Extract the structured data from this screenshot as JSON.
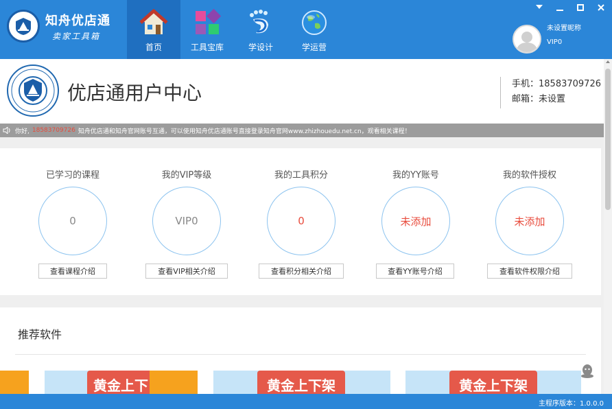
{
  "app": {
    "logo_title": "知舟优店通",
    "logo_subtitle": "卖家工具箱"
  },
  "nav": {
    "items": [
      {
        "label": "首页",
        "icon": "home-icon",
        "active": true
      },
      {
        "label": "工具宝库",
        "icon": "toolbox-icon",
        "active": false
      },
      {
        "label": "学设计",
        "icon": "design-icon",
        "active": false
      },
      {
        "label": "学运营",
        "icon": "globe-icon",
        "active": false
      }
    ]
  },
  "window_controls": [
    "dropdown-icon",
    "minimize-icon",
    "maximize-icon",
    "close-icon"
  ],
  "user": {
    "nickname": "未设置昵称",
    "vip": "VIP0"
  },
  "header": {
    "title": "优店通用户中心",
    "phone_label": "手机：18583709726",
    "email_label": "邮箱：未设置"
  },
  "notice": {
    "prefix": "你好,",
    "phone": "18583709726",
    "message": "知舟优店通和知舟官网账号互通，可以使用知舟优店通账号直接登录知舟官网www.zhizhouedu.net.cn，观看相关课程！"
  },
  "stats": [
    {
      "title": "已学习的课程",
      "value": "0",
      "button": "查看课程介绍",
      "highlight": false
    },
    {
      "title": "我的VIP等级",
      "value": "VIP0",
      "button": "查看VIP相关介绍",
      "highlight": false
    },
    {
      "title": "我的工具积分",
      "value": "0",
      "button": "查看积分相关介绍",
      "highlight": true
    },
    {
      "title": "我的YY账号",
      "value": "未添加",
      "button": "查看YY账号介绍",
      "highlight": true
    },
    {
      "title": "我的软件授权",
      "value": "未添加",
      "button": "查看软件权限介绍",
      "highlight": true
    }
  ],
  "recommend": {
    "title": "推荐软件",
    "cards": [
      {
        "tag": "黄金上下"
      },
      {
        "tag": "黄金上下架"
      },
      {
        "tag": "黄金上下架"
      }
    ]
  },
  "footer": {
    "version": "主程序版本：1.0.0.0"
  },
  "colors": {
    "primary": "#2b86d8",
    "nav_active": "#1f6fc0",
    "accent_red": "#e84b3c",
    "circle_border": "#8cc3ef",
    "notice_bg": "#9c9c9c"
  }
}
